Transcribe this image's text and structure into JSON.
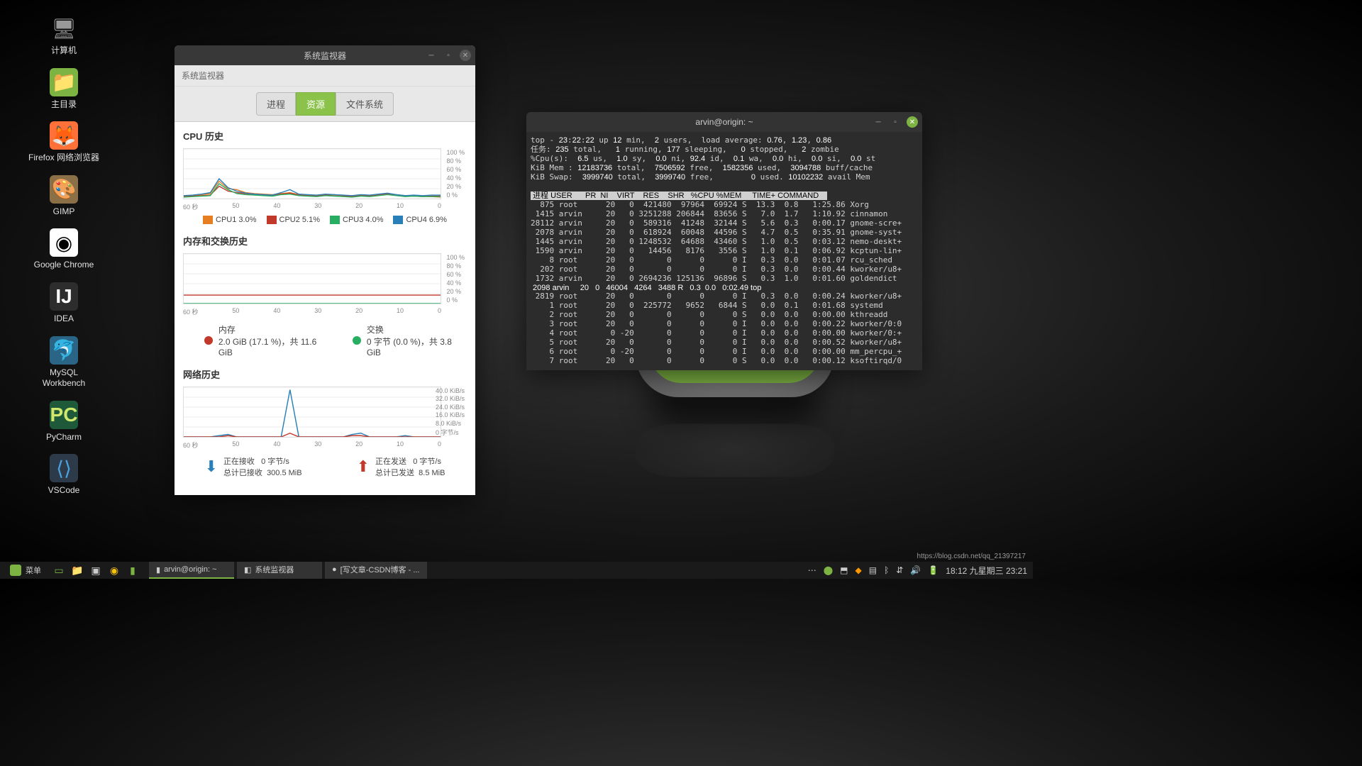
{
  "desktop_icons": [
    {
      "label": "计算机",
      "icon": "computer"
    },
    {
      "label": "主目录",
      "icon": "home"
    },
    {
      "label": "Firefox 网络浏览器",
      "icon": "firefox"
    },
    {
      "label": "GIMP",
      "icon": "gimp"
    },
    {
      "label": "Google Chrome",
      "icon": "chrome"
    },
    {
      "label": "IDEA",
      "icon": "idea"
    },
    {
      "label": "MySQL Workbench",
      "icon": "mysql"
    },
    {
      "label": "PyCharm",
      "icon": "pycharm"
    },
    {
      "label": "VSCode",
      "icon": "vscode"
    }
  ],
  "sysmon": {
    "title": "系统监视器",
    "menubar": "系统监视器",
    "tabs": {
      "processes": "进程",
      "resources": "资源",
      "filesystems": "文件系统"
    },
    "cpu": {
      "heading": "CPU 历史",
      "yticks": [
        "100 %",
        "80 %",
        "60 %",
        "40 %",
        "20 %",
        "0 %"
      ],
      "xticks": [
        "60 秒",
        "50",
        "40",
        "30",
        "20",
        "10",
        "0"
      ],
      "legend": [
        {
          "label": "CPU1 3.0%",
          "color": "#e67e22"
        },
        {
          "label": "CPU2 5.1%",
          "color": "#c0392b"
        },
        {
          "label": "CPU3 4.0%",
          "color": "#27ae60"
        },
        {
          "label": "CPU4 6.9%",
          "color": "#2980b9"
        }
      ]
    },
    "mem": {
      "heading": "内存和交换历史",
      "yticks": [
        "100 %",
        "80 %",
        "60 %",
        "40 %",
        "20 %",
        "0 %"
      ],
      "mem_title": "内存",
      "mem_value": "2.0 GiB (17.1 %)，共 11.6 GiB",
      "swap_title": "交换",
      "swap_value": "0 字节 (0.0 %)，共 3.8 GiB"
    },
    "net": {
      "heading": "网络历史",
      "yticks": [
        "40.0 KiB/s",
        "32.0 KiB/s",
        "24.0 KiB/s",
        "16.0 KiB/s",
        "8.0 KiB/s",
        "0 字节/s"
      ],
      "recv_title": "正在接收",
      "recv_rate": "0 字节/s",
      "recv_total_label": "总计已接收",
      "recv_total": "300.5 MiB",
      "send_title": "正在发送",
      "send_rate": "0 字节/s",
      "send_total_label": "总计已发送",
      "send_total": "8.5 MiB"
    }
  },
  "term": {
    "title": "arvin@origin: ~",
    "header": [
      "top - 23:22:22 up 12 min,  2 users,  load average: 0.76, 1.23, 0.86",
      "任务: 235 total,   1 running, 177 sleeping,   0 stopped,   2 zombie",
      "%Cpu(s):  6.5 us,  1.0 sy,  0.0 ni, 92.4 id,  0.1 wa,  0.0 hi,  0.0 si,  0.0 st",
      "KiB Mem : 12183736 total,  7506592 free,  1582356 used,  3094788 buff/cache",
      "KiB Swap:  3999740 total,  3999740 free,        0 used. 10102232 avail Mem"
    ],
    "cols": " 进程 USER      PR  NI    VIRT    RES    SHR   %CPU %MEM     TIME+ COMMAND    ",
    "rows": [
      "  875 root      20   0  421480  97964  69924 S  13.3  0.8   1:25.86 Xorg       ",
      " 1415 arvin     20   0 3251288 206844  83656 S   7.0  1.7   1:10.92 cinnamon   ",
      "28112 arvin     20   0  589316  41248  32144 S   5.6  0.3   0:00.17 gnome-scre+",
      " 2078 arvin     20   0  618924  60048  44596 S   4.7  0.5   0:35.91 gnome-syst+",
      " 1445 arvin     20   0 1248532  64688  43460 S   1.0  0.5   0:03.12 nemo-deskt+",
      " 1590 arvin     20   0   14456   8176   3556 S   1.0  0.1   0:06.92 kcptun-lin+",
      "    8 root      20   0       0      0      0 I   0.3  0.0   0:01.07 rcu_sched  ",
      "  202 root      20   0       0      0      0 I   0.3  0.0   0:00.44 kworker/u8+",
      " 1732 arvin     20   0 2694236 125136  96896 S   0.3  1.0   0:01.60 goldendict ",
      " 2098 arvin     20   0   46004   4264   3488 R   0.3  0.0   0:02.49 top        ",
      " 2819 root      20   0       0      0      0 I   0.3  0.0   0:00.24 kworker/u8+",
      "    1 root      20   0  225772   9652   6844 S   0.0  0.1   0:01.68 systemd    ",
      "    2 root      20   0       0      0      0 S   0.0  0.0   0:00.00 kthreadd   ",
      "    3 root      20   0       0      0      0 I   0.0  0.0   0:00.22 kworker/0:0",
      "    4 root       0 -20       0      0      0 I   0.0  0.0   0:00.00 kworker/0:+",
      "    5 root      20   0       0      0      0 I   0.0  0.0   0:00.52 kworker/u8+",
      "    6 root       0 -20       0      0      0 I   0.0  0.0   0:00.00 mm_percpu_+",
      "    7 root      20   0       0      0      0 S   0.0  0.0   0:00.12 ksoftirqd/0"
    ]
  },
  "taskbar": {
    "menu": "菜单",
    "wins": [
      {
        "label": "arvin@origin: ~",
        "icon": "▮"
      },
      {
        "label": "系统监视器",
        "icon": "◧"
      },
      {
        "label": "[写文章-CSDN博客 - ...",
        "icon": "●"
      }
    ],
    "clock": "18:12 九星期三 23:21"
  },
  "watermark": "https://blog.csdn.net/qq_21397217",
  "chart_data": {
    "cpu": {
      "type": "line",
      "x_range": "60-0 秒",
      "y_range": "0-100%",
      "series": [
        {
          "name": "CPU1",
          "color": "#e67e22",
          "current": 3.0,
          "values": [
            5,
            6,
            8,
            10,
            35,
            20,
            18,
            12,
            10,
            9,
            8,
            10,
            12,
            8,
            7,
            6,
            8,
            7,
            6,
            5,
            7,
            6,
            8,
            9,
            7,
            5,
            6,
            5,
            4,
            3
          ]
        },
        {
          "name": "CPU2",
          "color": "#c0392b",
          "current": 5.1,
          "values": [
            4,
            5,
            6,
            7,
            25,
            15,
            12,
            10,
            8,
            7,
            6,
            9,
            11,
            7,
            6,
            5,
            7,
            8,
            6,
            4,
            6,
            5,
            7,
            10,
            8,
            6,
            5,
            4,
            5,
            5
          ]
        },
        {
          "name": "CPU3",
          "color": "#27ae60",
          "current": 4.0,
          "values": [
            3,
            4,
            5,
            6,
            30,
            18,
            10,
            8,
            7,
            6,
            5,
            8,
            9,
            6,
            5,
            4,
            6,
            5,
            4,
            3,
            5,
            4,
            6,
            8,
            6,
            4,
            5,
            4,
            4,
            4
          ]
        },
        {
          "name": "CPU4",
          "color": "#2980b9",
          "current": 6.9,
          "values": [
            6,
            7,
            9,
            12,
            40,
            22,
            15,
            11,
            9,
            8,
            7,
            12,
            18,
            9,
            8,
            7,
            9,
            8,
            7,
            6,
            8,
            7,
            9,
            11,
            8,
            6,
            7,
            6,
            7,
            7
          ]
        }
      ]
    },
    "mem": {
      "type": "line",
      "y_range": "0-100%",
      "series": [
        {
          "name": "内存",
          "color": "#c0392b",
          "current": 17.1,
          "values": [
            17,
            17,
            17,
            17,
            17,
            17,
            17,
            17,
            17,
            17,
            17,
            17,
            17,
            17,
            17,
            17,
            17,
            17,
            17,
            17,
            17,
            17,
            17,
            17,
            17,
            17,
            17,
            17,
            17,
            17
          ]
        },
        {
          "name": "交换",
          "color": "#27ae60",
          "current": 0.0,
          "values": [
            0,
            0,
            0,
            0,
            0,
            0,
            0,
            0,
            0,
            0,
            0,
            0,
            0,
            0,
            0,
            0,
            0,
            0,
            0,
            0,
            0,
            0,
            0,
            0,
            0,
            0,
            0,
            0,
            0,
            0
          ]
        }
      ]
    },
    "net": {
      "type": "line",
      "y_range": "0-40 KiB/s",
      "series": [
        {
          "name": "接收",
          "color": "#2980b9",
          "values": [
            0,
            0,
            0,
            0,
            1,
            2,
            0,
            0,
            0,
            0,
            0,
            0,
            38,
            0,
            0,
            0,
            0,
            0,
            0,
            2,
            3,
            0,
            0,
            0,
            0,
            1,
            0,
            0,
            0,
            0
          ]
        },
        {
          "name": "发送",
          "color": "#c0392b",
          "values": [
            0,
            0,
            0,
            0,
            0,
            1,
            0,
            0,
            0,
            0,
            0,
            0,
            3,
            0,
            0,
            0,
            0,
            0,
            0,
            1,
            1,
            0,
            0,
            0,
            0,
            0,
            0,
            0,
            0,
            0
          ]
        }
      ]
    }
  }
}
